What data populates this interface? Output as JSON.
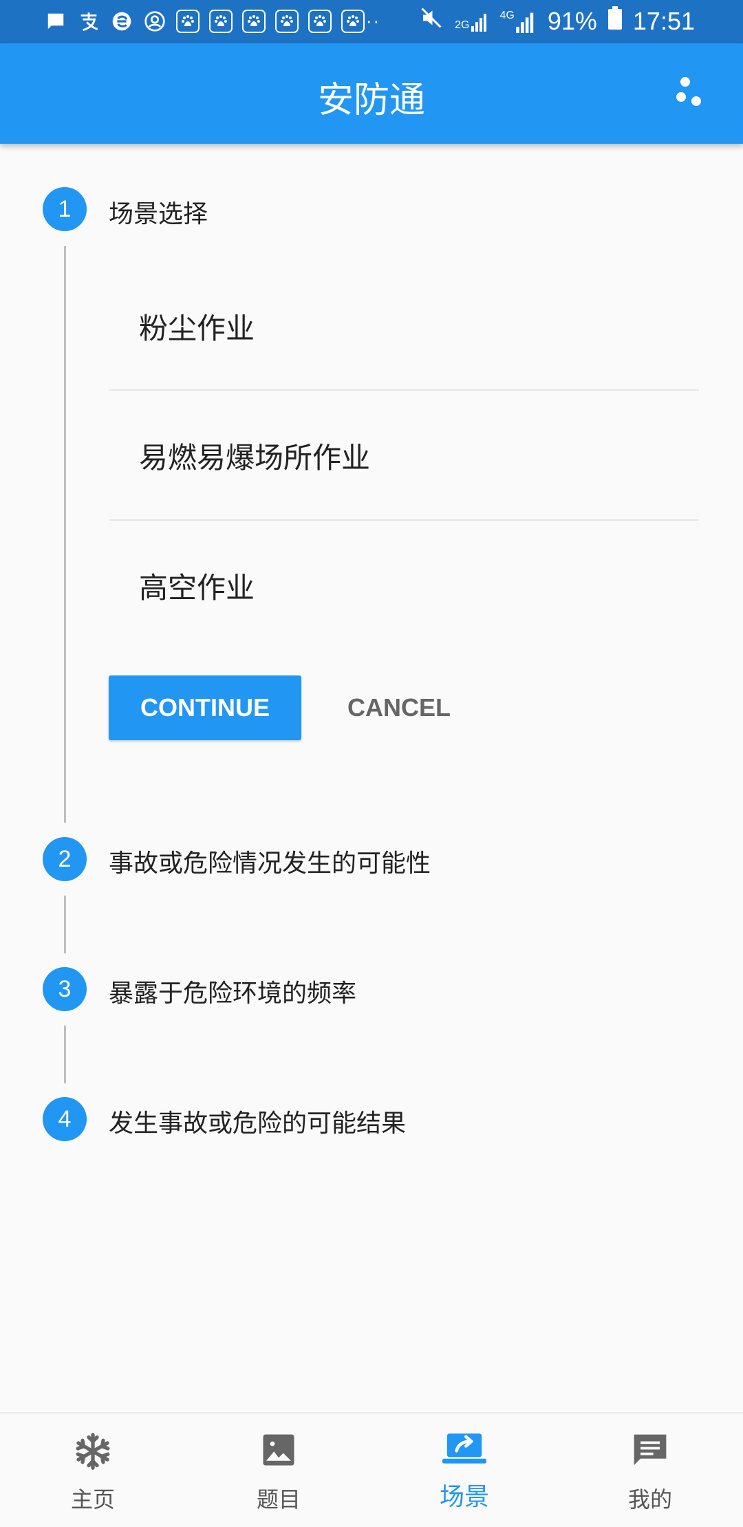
{
  "status_bar": {
    "left_icons": [
      "message-icon",
      "alipay-icon",
      "edge-icon",
      "account-icon",
      "baidu-icon",
      "baidu-icon",
      "baidu-icon",
      "baidu-icon",
      "baidu-icon",
      "baidu-icon"
    ],
    "network_2g": "2G",
    "network_4g": "4G",
    "battery": "91%",
    "time": "17:51"
  },
  "app_bar": {
    "title": "安防通"
  },
  "stepper": {
    "steps": [
      {
        "number": "1",
        "title": "场景选择"
      },
      {
        "number": "2",
        "title": "事故或危险情况发生的可能性"
      },
      {
        "number": "3",
        "title": "暴露于危险环境的频率"
      },
      {
        "number": "4",
        "title": "发生事故或危险的可能结果"
      }
    ],
    "options": [
      "粉尘作业",
      "易燃易爆场所作业",
      "高空作业"
    ],
    "continue_label": "CONTINUE",
    "cancel_label": "CANCEL"
  },
  "bottom_nav": {
    "items": [
      {
        "label": "主页",
        "icon": "snowflake-icon"
      },
      {
        "label": "题目",
        "icon": "image-icon"
      },
      {
        "label": "场景",
        "icon": "share-laptop-icon"
      },
      {
        "label": "我的",
        "icon": "chat-icon"
      }
    ],
    "active": "场景"
  },
  "colors": {
    "primary": "#2196f3",
    "status_bar": "#1e72c4",
    "background": "#fafafa"
  }
}
